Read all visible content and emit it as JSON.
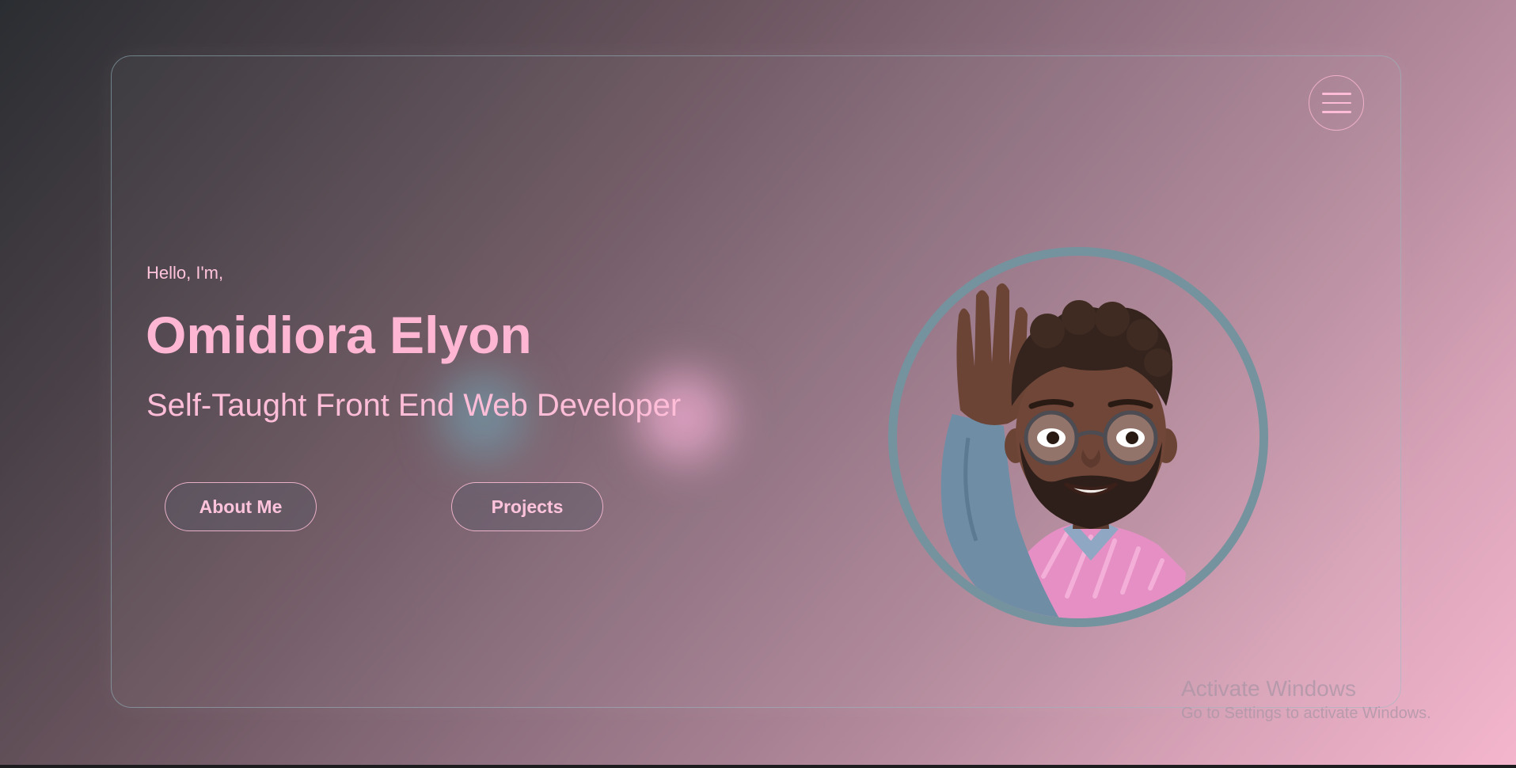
{
  "header": {
    "menu_icon": "hamburger-menu-icon"
  },
  "hero": {
    "greeting": "Hello, I'm,",
    "name": "Omidiora Elyon",
    "subtitle": "Self-Taught Front End Web Developer",
    "buttons": {
      "about_label": "About Me",
      "projects_label": "Projects"
    },
    "avatar_icon": "memoji-avatar-icon"
  },
  "watermark": {
    "title": "Activate Windows",
    "subtitle": "Go to Settings to activate Windows."
  },
  "colors": {
    "accent_pink": "#ffb6d3",
    "ring_blue": "#75939e"
  }
}
